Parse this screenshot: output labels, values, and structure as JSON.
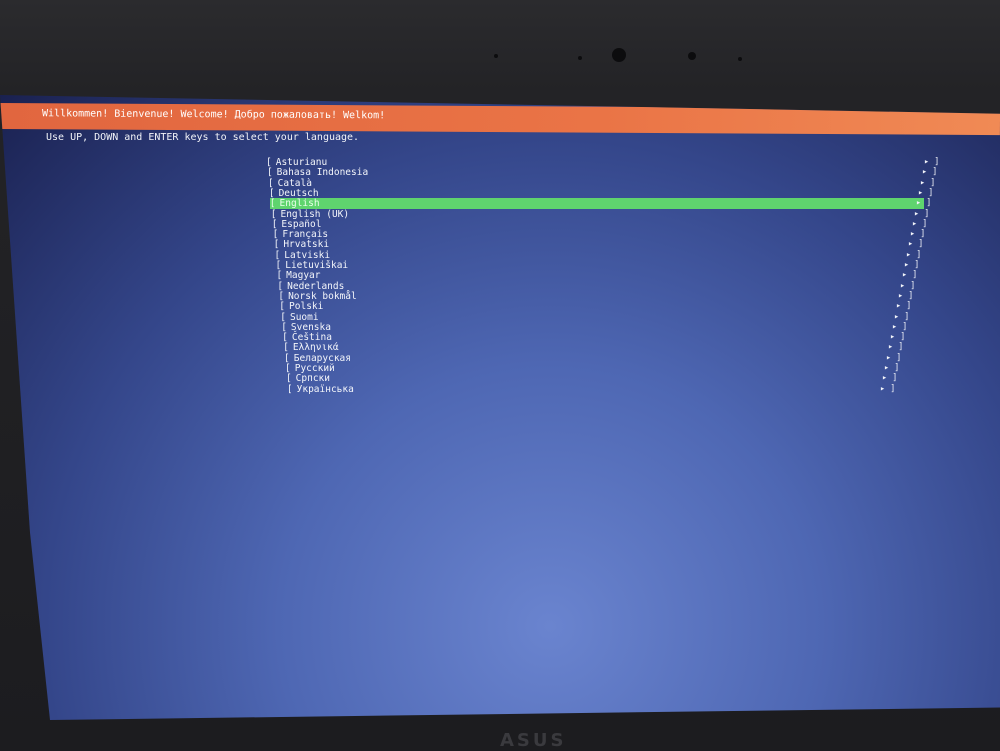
{
  "header": {
    "welcome_text": "Willkommen! Bienvenue! Welcome! Добро пожаловать! Welkom!"
  },
  "instruction": "Use UP, DOWN and ENTER keys to select your language.",
  "languages": [
    "Asturianu",
    "Bahasa Indonesia",
    "Català",
    "Deutsch",
    "English",
    "English (UK)",
    "Español",
    "Français",
    "Hrvatski",
    "Latviski",
    "Lietuviškai",
    "Magyar",
    "Nederlands",
    "Norsk bokmål",
    "Polski",
    "Suomi",
    "Svenska",
    "Čeština",
    "Ελληνικά",
    "Беларуская",
    "Русский",
    "Српски",
    "Українська"
  ],
  "selected_index": 4,
  "row_prefix": "[",
  "row_suffix": "▸ ]",
  "colors": {
    "header_orange": "#e9714a",
    "selection_green": "#5fd46e",
    "screen_blue": "#4e67b3"
  },
  "icons": {
    "row_arrow": "right-arrow-icon"
  }
}
